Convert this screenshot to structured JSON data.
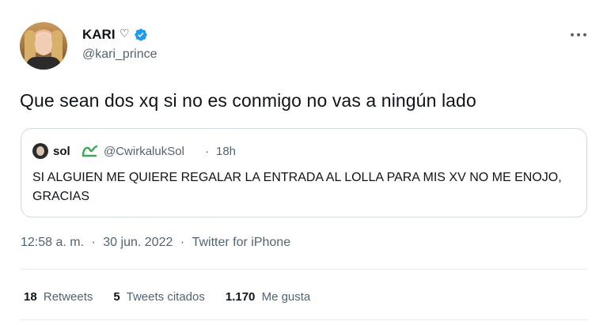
{
  "author": {
    "name": "KARI",
    "name_symbol": "♡",
    "handle": "@kari_prince"
  },
  "tweet": {
    "text": "Que sean dos xq si no es conmigo no vas a ningún lado"
  },
  "quoted": {
    "name": "sol",
    "handle": "@CwirkalukSol",
    "separator": "·",
    "time": "18h",
    "text": "SI ALGUIEN ME QUIERE REGALAR LA ENTRADA AL LOLLA PARA MIS XV NO ME ENOJO, GRACIAS"
  },
  "meta": {
    "time": "12:58 a. m.",
    "sep1": "·",
    "date": "30 jun. 2022",
    "sep2": "·",
    "source": "Twitter for iPhone"
  },
  "stats": {
    "retweets_count": "18",
    "retweets_label": "Retweets",
    "quotes_count": "5",
    "quotes_label": "Tweets citados",
    "likes_count": "1.170",
    "likes_label": "Me gusta"
  },
  "colors": {
    "verified": "#1d9bf0",
    "secondary_text": "#536471",
    "badge_green": "#3aa856"
  },
  "icons": {
    "verified": "verified-badge-icon",
    "more": "more-options-icon",
    "quoted_badge": "green-wave-icon"
  }
}
